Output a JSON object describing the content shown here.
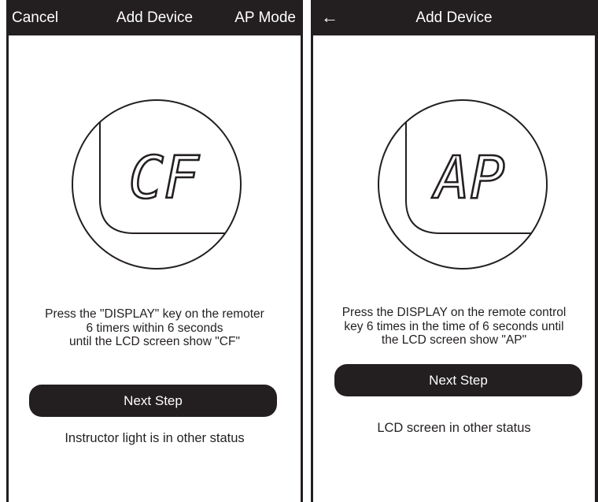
{
  "left_screen": {
    "header": {
      "cancel_label": "Cancel",
      "title": "Add Device",
      "mode_label": "AP Mode"
    },
    "lcd_text": "CF",
    "instructions": [
      "Press the \"DISPLAY\" key on the remoter",
      "6 timers within 6 seconds",
      "until the LCD screen show \"CF\""
    ],
    "next_button": "Next Step",
    "status_link": "Instructor light is in other status"
  },
  "right_screen": {
    "header": {
      "back_icon": "arrow-left",
      "title": "Add Device"
    },
    "lcd_text": "AP",
    "instructions": [
      "Press the DISPLAY on the remote control",
      "key 6 times in the time of 6 seconds until",
      "the LCD screen show \"AP\""
    ],
    "next_button": "Next Step",
    "status_link": "LCD screen in other status"
  },
  "colors": {
    "dark": "#231f20",
    "background": "#ffffff"
  }
}
